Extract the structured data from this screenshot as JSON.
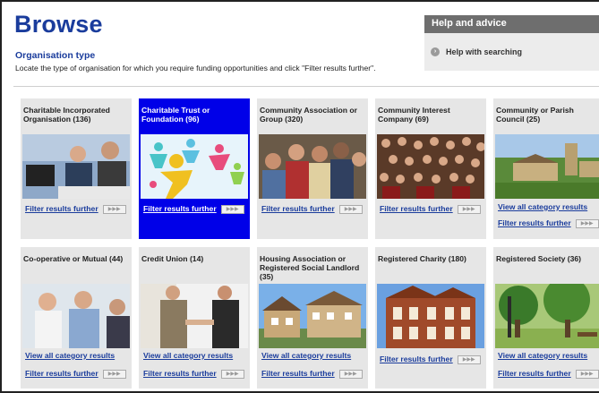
{
  "header": {
    "title": "Browse",
    "section_title": "Organisation type",
    "instruction": "Locate the type of organisation for which you require funding opportunities and click \"Filter results further\"."
  },
  "help": {
    "title": "Help and advice",
    "item": "Help with searching",
    "item_icon": "circle-arrow-icon"
  },
  "colors": {
    "brand_blue": "#1a3c9c",
    "active_card": "#0000e8",
    "card_bg": "#e6e6e6",
    "help_header": "#6e6e6e"
  },
  "arrow_pill": "▶▶▶",
  "cards": [
    {
      "title": "Charitable Incorporated Organisation (136)",
      "filter": "Filter results further",
      "image": "office-people-photo"
    },
    {
      "title": "Charitable Trust or Foundation (96)",
      "filter": "Filter results further",
      "image": "dancing-figures-illustration",
      "selected": true
    },
    {
      "title": "Community Association or Group (320)",
      "filter": "Filter results further",
      "image": "group-people-photo"
    },
    {
      "title": "Community Interest Company (69)",
      "filter": "Filter results further",
      "image": "crowd-photo"
    },
    {
      "title": "Community or Parish Council (25)",
      "view_all": "View all category results",
      "filter": "Filter results further",
      "image": "village-photo"
    },
    {
      "title": "Co-operative or Mutual (44)",
      "view_all": "View all category results",
      "filter": "Filter results further",
      "image": "team-meeting-photo"
    },
    {
      "title": "Credit Union (14)",
      "view_all": "View all category results",
      "filter": "Filter results further",
      "image": "handshake-photo"
    },
    {
      "title": "Housing Association or Registered Social Landlord (35)",
      "view_all": "View all category results",
      "filter": "Filter results further",
      "image": "houses-photo"
    },
    {
      "title": "Registered Charity (180)",
      "filter": "Filter results further",
      "image": "brick-building-photo"
    },
    {
      "title": "Registered Society (36)",
      "view_all": "View all category results",
      "filter": "Filter results further",
      "image": "park-photo"
    }
  ]
}
